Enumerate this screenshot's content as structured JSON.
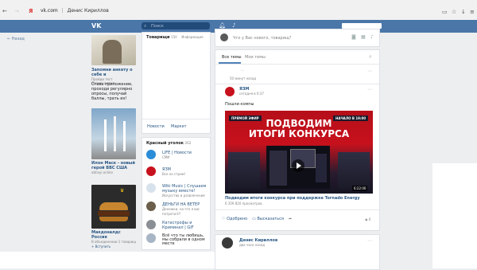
{
  "browser": {
    "back": "←",
    "yandex": "Я",
    "host": "vk.com",
    "page_title": "Денис Кириллов"
  },
  "vk": {
    "logo": "VK",
    "search_placeholder": "Поиск",
    "nav_back": "← Назад"
  },
  "left_ads": [
    {
      "title": "Запомни анкету о себе и",
      "sub": "Пройди тест",
      "desc": "Промокампия"
    },
    {
      "title": "",
      "sub": "",
      "desc": "Ставь приложение, проходи регулярно опросы, получай баллы, трать их!"
    },
    {
      "title": "Илон Маск - новый герой ВВС США",
      "sub": "",
      "desc": "abhayi.online"
    },
    {
      "title": "Макдоналдс Россия",
      "sub": "В объединении 1 товарищ",
      "desc": "+ Вступить"
    }
  ],
  "friends_block": {
    "title": "Товарищи",
    "count": "150",
    "tab2": "Информация",
    "tab_news": "Новости",
    "tab_market": "Маркет"
  },
  "red_corner": {
    "title": "Красный уголок",
    "count": "262",
    "items": [
      {
        "name": "LIFE | Новости",
        "sub": "СМИ"
      },
      {
        "name": "ЯЗМ",
        "sub": "Все на стрим!"
      },
      {
        "name": "Wiki Music | Слушаем музыку вместе!",
        "sub": "Искусство и развлечения"
      },
      {
        "name": "ДЕНЬГИ НА ВЕТЕР",
        "sub": "Денежки, на что я вас потратил?!"
      },
      {
        "name": "Катастрофы и Криминал | GIF",
        "sub": ""
      },
      {
        "name": "Всё что ты любишь, мы собрали в одном месте",
        "sub": ""
      }
    ]
  },
  "composer": {
    "placeholder": "Что у Вас нового, товарищ?"
  },
  "feed_tabs": {
    "all": "Все темы",
    "mine": "Мои темы"
  },
  "post_small": {
    "time": "50 минут назад"
  },
  "post": {
    "author": "ЯЗМ",
    "time": "сегодня в 0:37",
    "text": "Пошли компы",
    "video_badge_left": "ПРЯМОЙ ЭФИР",
    "video_badge_right": "НАЧАЛО В 19:00",
    "video_title_l1": "ПОДВОДИМ",
    "video_title_l2": "ИТОГИ КОНКУРСА",
    "duration": "6:22:00",
    "caption": "Подводим итоги конкурса при поддержке Tornado Energy",
    "views": "6 359 820 просмотров",
    "like": "Одобрено",
    "share": "Высказаться",
    "count": "0"
  },
  "post2": {
    "author": "Денис Кириллов",
    "time": "два часа назад"
  },
  "colors": {
    "header": "#4a76a8",
    "search": "#224b7a",
    "link": "#2a5885",
    "video_red": "#c7111c",
    "video_dark": "#1a1a2a"
  }
}
